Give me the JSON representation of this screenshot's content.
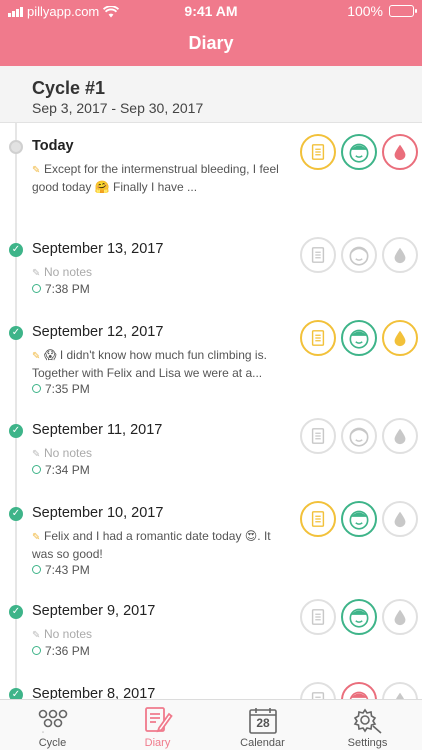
{
  "status_bar": {
    "carrier": "pillyapp.com",
    "time": "9:41 AM",
    "battery": "100%"
  },
  "header": {
    "title": "Diary"
  },
  "cycle": {
    "name": "Cycle #1",
    "range": "Sep 3, 2017 - Sep 30, 2017"
  },
  "entries": [
    {
      "date": "Today",
      "note": "Except for the intermenstrual bleeding, I feel good today 🤗 Finally I have ...",
      "time": ""
    },
    {
      "date": "September 13, 2017",
      "note": "No notes",
      "time": "7:38 PM"
    },
    {
      "date": "September 12, 2017",
      "note": "😱 I didn't know how much fun climbing is. Together with Felix and Lisa we were at a...",
      "time": "7:35 PM"
    },
    {
      "date": "September 11, 2017",
      "note": "No notes",
      "time": "7:34 PM"
    },
    {
      "date": "September 10, 2017",
      "note": "Felix and I had a romantic date today 😍. It was so good!",
      "time": "7:43 PM"
    },
    {
      "date": "September 9, 2017",
      "note": "No notes",
      "time": "7:36 PM"
    },
    {
      "date": "September 8, 2017",
      "note": "",
      "time": ""
    }
  ],
  "entry_icons": [
    {
      "note": "note-icon",
      "mood": "face-icon",
      "bleeding": "drop-icon",
      "colors": [
        "#f2c13a",
        "#3eb489",
        "#ea6e7c"
      ]
    },
    {
      "colors": [
        "#e0e0e0",
        "#e0e0e0",
        "#e0e0e0"
      ]
    },
    {
      "colors": [
        "#f2c13a",
        "#3eb489",
        "#f2c13a"
      ]
    },
    {
      "colors": [
        "#e0e0e0",
        "#e0e0e0",
        "#e0e0e0"
      ]
    },
    {
      "colors": [
        "#f2c13a",
        "#3eb489",
        "#e0e0e0"
      ]
    },
    {
      "colors": [
        "#e0e0e0",
        "#3eb489",
        "#e0e0e0"
      ]
    },
    {
      "colors": [
        "#e0e0e0",
        "#ea6e7c",
        "#e0e0e0"
      ]
    }
  ],
  "tabs": [
    {
      "label": "Cycle",
      "icon": "cycle-icon"
    },
    {
      "label": "Diary",
      "icon": "diary-icon",
      "active": true
    },
    {
      "label": "Calendar",
      "icon": "calendar-icon",
      "day": "28"
    },
    {
      "label": "Settings",
      "icon": "gear-icon"
    }
  ],
  "colors": {
    "brand": "#f07a8c",
    "green": "#3eb489",
    "yellow": "#f2c13a",
    "red": "#ea6e7c"
  }
}
